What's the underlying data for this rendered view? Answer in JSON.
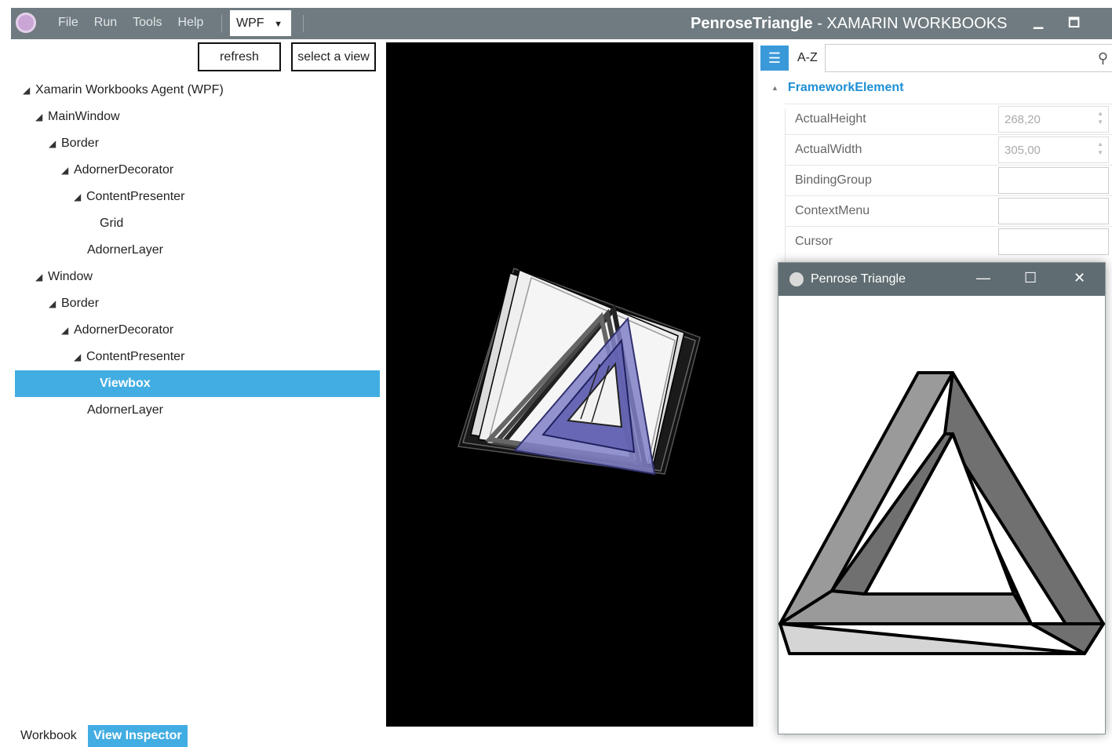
{
  "titlebar": {
    "menu": [
      "File",
      "Run",
      "Tools",
      "Help"
    ],
    "agent_select": "WPF",
    "doc_name": "PenroseTriangle",
    "app_name": "- XAMARIN WORKBOOKS"
  },
  "toolbar": {
    "refresh_label": "refresh",
    "select_view_label": "select a view"
  },
  "tree": [
    {
      "label": "Xamarin Workbooks Agent (WPF)",
      "expanded": true
    },
    {
      "label": "MainWindow",
      "expanded": true
    },
    {
      "label": "Border",
      "expanded": true
    },
    {
      "label": "AdornerDecorator",
      "expanded": true
    },
    {
      "label": "ContentPresenter",
      "expanded": true
    },
    {
      "label": "Grid",
      "expanded": false
    },
    {
      "label": "AdornerLayer",
      "expanded": false
    },
    {
      "label": "Window",
      "expanded": true
    },
    {
      "label": "Border",
      "expanded": true
    },
    {
      "label": "AdornerDecorator",
      "expanded": true
    },
    {
      "label": "ContentPresenter",
      "expanded": true
    },
    {
      "label": "Viewbox",
      "expanded": false,
      "selected": true
    },
    {
      "label": "AdornerLayer",
      "expanded": false
    }
  ],
  "properties": {
    "sort_label": "A-Z",
    "search_placeholder": "",
    "category": "FrameworkElement",
    "rows": [
      {
        "name": "ActualHeight",
        "value": "268,20"
      },
      {
        "name": "ActualWidth",
        "value": "305,00"
      },
      {
        "name": "BindingGroup",
        "value": ""
      },
      {
        "name": "ContextMenu",
        "value": ""
      },
      {
        "name": "Cursor",
        "value": ""
      }
    ]
  },
  "popup": {
    "title": "Penrose Triangle"
  },
  "footer": {
    "workbook_tab": "Workbook",
    "inspector_tab": "View Inspector"
  },
  "colors": {
    "titlebar": "#6f7b80",
    "accent": "#42ade2",
    "popup_titlebar": "#5f6c71",
    "category": "#1e8fd5"
  }
}
